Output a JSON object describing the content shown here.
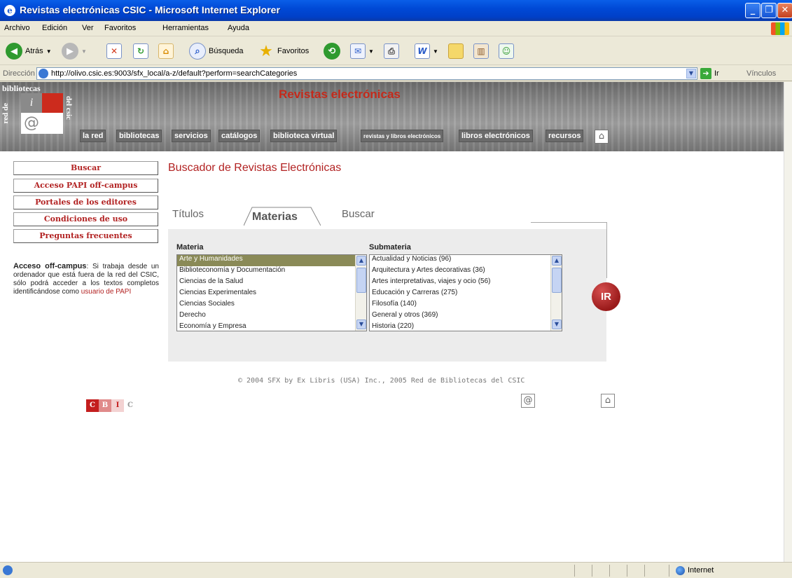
{
  "window": {
    "title": "Revistas electrónicas CSIC - Microsoft Internet Explorer"
  },
  "menu": [
    "Archivo",
    "Edición",
    "Ver",
    "Favoritos",
    "Herramientas",
    "Ayuda"
  ],
  "toolbar": {
    "back_label": "Atrás",
    "search_label": "Búsqueda",
    "favorites_label": "Favoritos"
  },
  "address": {
    "label": "Dirección",
    "url": "http://olivo.csic.es:9003/sfx_local/a-z/default?perform=searchCategories",
    "go_label": "Ir",
    "links_label": "Vínculos"
  },
  "banner": {
    "top_label": "bibliotecas",
    "red_de": "red de",
    "del_csic": "del csic",
    "site_title": "Revistas electrónicas",
    "nav": [
      "la red",
      "bibliotecas",
      "servicios",
      "catálogos",
      "biblioteca virtual",
      "revistas y libros electrónicos",
      "libros electrónicos",
      "recursos"
    ]
  },
  "sidebar": {
    "items": [
      "Buscar",
      "Acceso PAPI off-campus",
      "Portales de los editores",
      "Condiciones de uso",
      "Preguntas frecuentes"
    ],
    "offcampus_title": "Acceso off-campus",
    "offcampus_text": ": Si trabaja desde un ordenador que está fuera de la red del CSIC, sólo podrá acceder a los textos completos identificándose como ",
    "offcampus_link": "usuario de PAPI",
    "cbic": [
      "C",
      "B",
      "I",
      "C"
    ]
  },
  "main": {
    "title": "Buscador de Revistas Electrónicas",
    "tabs": [
      "Títulos",
      "Materias",
      "Buscar"
    ],
    "materia_label": "Materia",
    "submateria_label": "Submateria",
    "materias": [
      "Arte y Humanidades",
      "Biblioteconomía y Documentación",
      "Ciencias de la Salud",
      "Ciencias Experimentales",
      "Ciencias Sociales",
      "Derecho",
      "Economía y Empresa"
    ],
    "submaterias": [
      "Actualidad y Noticias (96)",
      "Arquitectura y Artes decorativas (36)",
      "Artes interpretativas, viajes y ocio (56)",
      "Educación y Carreras (275)",
      "Filosofía (140)",
      "General y otros (369)",
      "Historia (220)"
    ],
    "ir_label": "IR",
    "copyright": "© 2004 SFX by Ex Libris (USA) Inc., 2005 Red de Bibliotecas del CSIC"
  },
  "status": {
    "zone": "Internet"
  }
}
